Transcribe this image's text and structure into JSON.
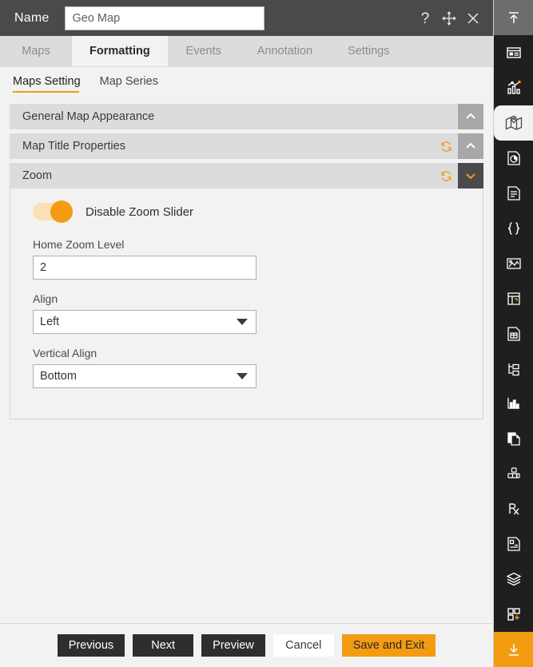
{
  "titlebar": {
    "name_label": "Name",
    "name_value": "Geo Map",
    "name_placeholder": "Name",
    "help_icon": "question-mark-icon",
    "move_icon": "move-arrows-icon",
    "close_icon": "close-icon"
  },
  "tabs": [
    {
      "label": "Maps",
      "active": false
    },
    {
      "label": "Formatting",
      "active": true
    },
    {
      "label": "Events",
      "active": false
    },
    {
      "label": "Annotation",
      "active": false
    },
    {
      "label": "Settings",
      "active": false
    }
  ],
  "subtabs": [
    {
      "label": "Maps Setting",
      "active": true
    },
    {
      "label": "Map Series",
      "active": false
    }
  ],
  "accordions": [
    {
      "title": "General Map Appearance",
      "expanded": false,
      "has_refresh": false,
      "chevron": "chevron-up"
    },
    {
      "title": "Map Title Properties",
      "expanded": false,
      "has_refresh": true,
      "chevron": "chevron-up"
    },
    {
      "title": "Zoom",
      "expanded": true,
      "has_refresh": true,
      "chevron": "chevron-down"
    }
  ],
  "zoom_panel": {
    "toggle": {
      "label": "Disable Zoom Slider",
      "state": "on"
    },
    "home_zoom_level": {
      "label": "Home Zoom Level",
      "value": "2",
      "placeholder": ""
    },
    "align": {
      "label": "Align",
      "value": "Left"
    },
    "vertical_align": {
      "label": "Vertical Align",
      "value": "Bottom"
    }
  },
  "footer": {
    "previous": "Previous",
    "next": "Next",
    "preview": "Preview",
    "cancel": "Cancel",
    "save_and_exit": "Save and Exit"
  },
  "rail": [
    {
      "icon": "collapse-up-icon",
      "state": "top-active"
    },
    {
      "icon": "dashboard-panel-icon",
      "state": "normal"
    },
    {
      "icon": "chart-analytics-icon",
      "state": "normal"
    },
    {
      "icon": "map-location-icon",
      "state": "selected"
    },
    {
      "icon": "pie-chart-document-icon",
      "state": "normal"
    },
    {
      "icon": "document-icon",
      "state": "normal"
    },
    {
      "icon": "code-braces-icon",
      "state": "normal"
    },
    {
      "icon": "image-gallery-icon",
      "state": "normal"
    },
    {
      "icon": "table-grid-icon",
      "state": "normal"
    },
    {
      "icon": "report-document-icon",
      "state": "normal"
    },
    {
      "icon": "tree-hierarchy-icon",
      "state": "normal"
    },
    {
      "icon": "bar-chart-icon",
      "state": "normal"
    },
    {
      "icon": "copy-pages-icon",
      "state": "normal"
    },
    {
      "icon": "cubes-stack-icon",
      "state": "normal"
    },
    {
      "icon": "prescription-rx-icon",
      "state": "normal"
    },
    {
      "icon": "detail-document-icon",
      "state": "normal"
    },
    {
      "icon": "layers-icon",
      "state": "normal"
    },
    {
      "icon": "add-widget-icon",
      "state": "normal"
    },
    {
      "icon": "download-icon",
      "state": "bottom-accent"
    }
  ],
  "colors": {
    "accent": "#f39c12",
    "titlebar": "#4a4a4a",
    "rail": "#1f1f1f",
    "panel": "#f2f2f2",
    "accordion_header": "#dcdcdc"
  }
}
